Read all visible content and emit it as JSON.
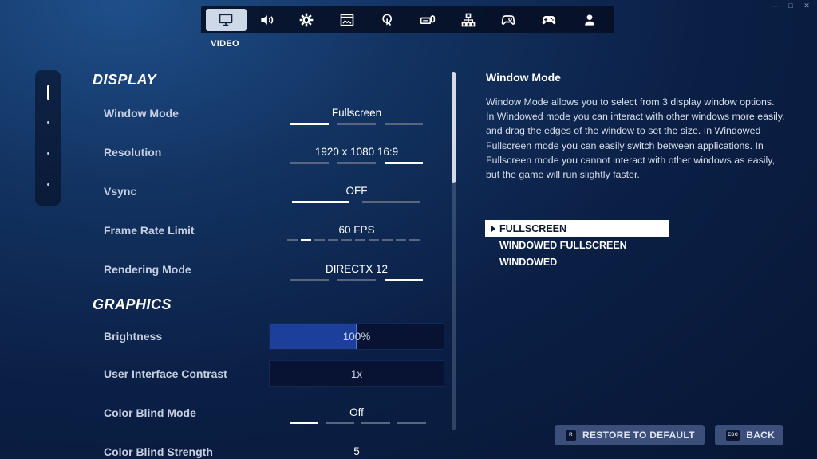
{
  "tabs": [
    {
      "name": "video",
      "icon": "monitor-icon",
      "active": true
    },
    {
      "name": "audio",
      "icon": "speaker-icon"
    },
    {
      "name": "game",
      "icon": "gear-icon"
    },
    {
      "name": "accessibility",
      "icon": "display-settings-icon"
    },
    {
      "name": "touch",
      "icon": "touch-icon"
    },
    {
      "name": "keyboard",
      "icon": "keyboard-mouse-icon"
    },
    {
      "name": "controller-config",
      "icon": "hierarchy-icon"
    },
    {
      "name": "controller",
      "icon": "gamepad-settings-icon"
    },
    {
      "name": "gamepad",
      "icon": "gamepad-icon"
    },
    {
      "name": "account",
      "icon": "user-icon"
    }
  ],
  "active_tab_label": "VIDEO",
  "display": {
    "title": "DISPLAY",
    "window_mode": {
      "label": "Window Mode",
      "value": "Fullscreen",
      "segments": 3,
      "selected_index": 0
    },
    "resolution": {
      "label": "Resolution",
      "value": "1920 x 1080 16:9",
      "segments": 3,
      "selected_index": 2
    },
    "vsync": {
      "label": "Vsync",
      "value": "OFF",
      "segments": 2,
      "selected_index": 0
    },
    "frame_rate": {
      "label": "Frame Rate Limit",
      "value": "60 FPS",
      "segments": 10,
      "selected_index": 1
    },
    "rendering_mode": {
      "label": "Rendering Mode",
      "value": "DIRECTX 12",
      "segments": 3,
      "selected_index": 2
    }
  },
  "graphics": {
    "title": "GRAPHICS",
    "brightness": {
      "label": "Brightness",
      "value": "100%",
      "fill_fraction": 0.5
    },
    "ui_contrast": {
      "label": "User Interface Contrast",
      "value": "1x",
      "fill_fraction": 0
    },
    "color_blind_mode": {
      "label": "Color Blind Mode",
      "value": "Off",
      "segments": 4,
      "selected_index": 0
    },
    "color_blind_strength": {
      "label": "Color Blind Strength",
      "value": "5"
    }
  },
  "detail": {
    "title": "Window Mode",
    "description": "Window Mode allows you to select from 3 display window options. In Windowed mode you can interact with other windows more easily, and drag the edges of the window to set the size. In Windowed Fullscreen mode you can easily switch between applications. In Fullscreen mode you cannot interact with other windows as easily, but the game will run slightly faster.",
    "options": [
      "FULLSCREEN",
      "WINDOWED FULLSCREEN",
      "WINDOWED"
    ],
    "selected_option": 0
  },
  "buttons": {
    "restore_key": "R",
    "restore_label": "RESTORE TO DEFAULT",
    "back_key": "ESC",
    "back_label": "BACK"
  },
  "colors": {
    "accent_fill": "#1c3f9c",
    "background": "#0b1f45"
  }
}
